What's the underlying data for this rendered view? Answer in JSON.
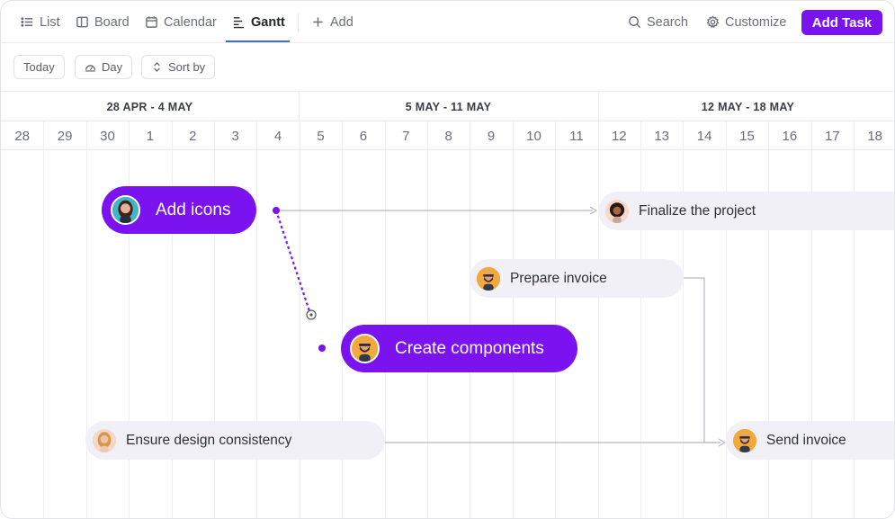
{
  "views": {
    "tabs": [
      {
        "label": "List",
        "icon": "list-icon"
      },
      {
        "label": "Board",
        "icon": "board-icon"
      },
      {
        "label": "Calendar",
        "icon": "calendar-icon"
      },
      {
        "label": "Gantt",
        "icon": "gantt-icon",
        "active": true
      }
    ],
    "add_label": "Add"
  },
  "actions": {
    "search_label": "Search",
    "customize_label": "Customize",
    "add_task_label": "Add Task"
  },
  "toolbar": {
    "today_label": "Today",
    "day_label": "Day",
    "sort_label": "Sort by"
  },
  "timeline": {
    "weeks": [
      "28 APR - 4 MAY",
      "5 MAY - 11 MAY",
      "12 MAY - 18 MAY"
    ],
    "days": [
      "28",
      "29",
      "30",
      "1",
      "2",
      "3",
      "4",
      "5",
      "6",
      "7",
      "8",
      "9",
      "10",
      "11",
      "12",
      "13",
      "14",
      "15",
      "16",
      "17",
      "18"
    ]
  },
  "tasks": {
    "add_icons": "Add icons",
    "finalize": "Finalize the project",
    "prepare_invoice": "Prepare invoice",
    "create_components": "Create components",
    "ensure_design": "Ensure design consistency",
    "send_invoice": "Send invoice"
  },
  "colors": {
    "accent": "#7b12f0",
    "light_bar": "#f1f0f7",
    "tab_underline": "#3b6de0"
  }
}
